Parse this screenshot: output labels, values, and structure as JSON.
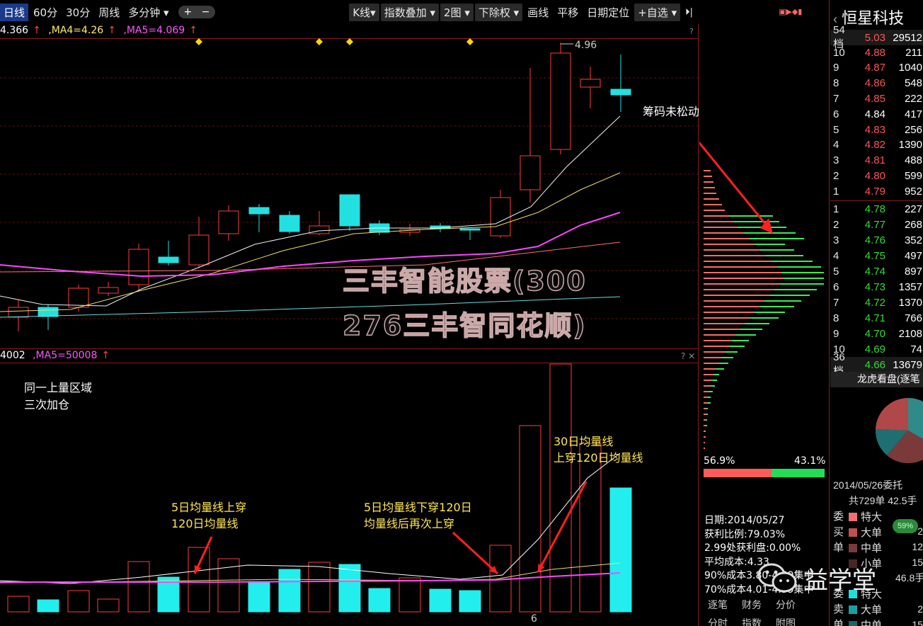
{
  "toolbar": {
    "items": [
      "日线",
      "60分",
      "30分",
      "周线",
      "多分钟 ▾",
      "K线▾",
      "指数叠加 ▾",
      "2图 ▾",
      "下除权 ▾",
      "画线",
      "平移",
      "日期定位",
      "+自选 ▾"
    ],
    "plus": "+",
    "minus": "−",
    "end_icon": "⏵|"
  },
  "ma_top": {
    "ma3": "4.366",
    "ma4": ",MA4=4.26",
    "ma5": ",MA5=4.069",
    "q": "?"
  },
  "ma_vol": {
    "v1": "4002",
    "ma5": ",MA5=50008",
    "q": "? ✕"
  },
  "high_price": "4.96",
  "x_tick": "6",
  "notes": {
    "chips_unmoved": "筹码未松动",
    "same_zone_1": "同一上量区域",
    "same_zone_2": "三次加仓",
    "ma30_1": "30日均量线",
    "ma30_2": "上穿120日均量线",
    "ma5_1": "5日均量线上穿",
    "ma5_2": "120日均量线",
    "ma5b_1": "5日均量线下穿120日",
    "ma5b_2": "均量线后再次上穿"
  },
  "watermark": {
    "line1": "三丰智能股票(300",
    "line2": "276三丰智同花顺)"
  },
  "chip_panel": {
    "left_pct": "56.9%",
    "right_pct": "43.1%"
  },
  "chip_stats": [
    "日期:2014/05/27",
    "获利比例:79.03%",
    "2.99处获利盘:0.00%",
    "平均成本:4.33",
    "90%成本3.80-4.89集中",
    "70%成本4.01-4.39集中"
  ],
  "bottom_tabs": {
    "row1": [
      "逐笔",
      "财务",
      "分价"
    ],
    "row2": [
      "分时",
      "指数",
      "附图"
    ]
  },
  "order_book": {
    "title": "恒星科技",
    "header": {
      "label": "54档",
      "price": "5.03",
      "vol": "29512"
    },
    "asks": [
      {
        "n": "10",
        "p": "4.88",
        "v": "211"
      },
      {
        "n": "9",
        "p": "4.87",
        "v": "1040"
      },
      {
        "n": "8",
        "p": "4.86",
        "v": "548"
      },
      {
        "n": "7",
        "p": "4.85",
        "v": "222"
      },
      {
        "n": "6",
        "p": "4.84",
        "v": "417"
      },
      {
        "n": "5",
        "p": "4.83",
        "v": "256"
      },
      {
        "n": "4",
        "p": "4.82",
        "v": "1390"
      },
      {
        "n": "3",
        "p": "4.81",
        "v": "488"
      },
      {
        "n": "2",
        "p": "4.80",
        "v": "599"
      },
      {
        "n": "1",
        "p": "4.79",
        "v": "952"
      }
    ],
    "bids": [
      {
        "n": "1",
        "p": "4.78",
        "v": "227"
      },
      {
        "n": "2",
        "p": "4.77",
        "v": "268"
      },
      {
        "n": "3",
        "p": "4.76",
        "v": "352"
      },
      {
        "n": "4",
        "p": "4.75",
        "v": "497"
      },
      {
        "n": "5",
        "p": "4.74",
        "v": "897"
      },
      {
        "n": "6",
        "p": "4.73",
        "v": "1357"
      },
      {
        "n": "7",
        "p": "4.72",
        "v": "1370"
      },
      {
        "n": "8",
        "p": "4.71",
        "v": "766"
      },
      {
        "n": "9",
        "p": "4.70",
        "v": "2108"
      },
      {
        "n": "10",
        "p": "4.69",
        "v": "74"
      }
    ],
    "footer": {
      "label": "36档",
      "price": "4.66",
      "vol": "13679"
    },
    "dragon": "龙虎看盘(逐笔",
    "date": "2014/05/26委托",
    "total": "共729单 42.5手",
    "pie_pct": "59%",
    "buy_labels": [
      "特大",
      "大单",
      "中单",
      "小单"
    ],
    "sell_labels": [
      "特大",
      "大单",
      "中单"
    ],
    "side_buy": "委买单",
    "side_sell": "委卖单",
    "sell_total": "46.8手",
    "vals": [
      "2",
      "12",
      "15",
      "2",
      "15"
    ]
  },
  "brand": "益学堂"
}
